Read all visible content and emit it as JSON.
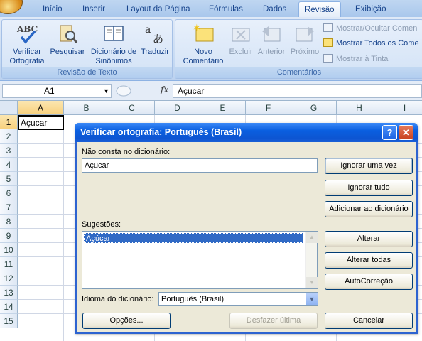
{
  "ribbon": {
    "tabs": [
      {
        "label": "Início"
      },
      {
        "label": "Inserir"
      },
      {
        "label": "Layout da Página"
      },
      {
        "label": "Fórmulas"
      },
      {
        "label": "Dados"
      },
      {
        "label": "Revisão"
      },
      {
        "label": "Exibição"
      }
    ],
    "active_tab": "Revisão",
    "groups": {
      "revisao_texto": {
        "label": "Revisão de Texto",
        "buttons": {
          "verificar": {
            "line1": "Verificar",
            "line2": "Ortografia"
          },
          "pesquisar": {
            "line1": "Pesquisar",
            "line2": ""
          },
          "dicionario": {
            "line1": "Dicionário de",
            "line2": "Sinônimos"
          },
          "traduzir": {
            "line1": "Traduzir",
            "line2": ""
          }
        }
      },
      "comentarios": {
        "label": "Comentários",
        "buttons": {
          "novo": {
            "line1": "Novo",
            "line2": "Comentário"
          },
          "excluir": {
            "line1": "Excluir"
          },
          "anterior": {
            "line1": "Anterior"
          },
          "proximo": {
            "line1": "Próximo"
          }
        },
        "small_buttons": {
          "mostrar_ocultar": "Mostrar/Ocultar Comen",
          "mostrar_todos": "Mostrar Todos os Come",
          "mostrar_tinta": "Mostrar à Tinta"
        }
      }
    }
  },
  "formula_bar": {
    "name_box": "A1",
    "fx": "fx",
    "content": "Açucar"
  },
  "grid": {
    "columns": [
      "A",
      "B",
      "C",
      "D",
      "E",
      "F",
      "G",
      "H",
      "I"
    ],
    "rows": [
      "1",
      "2",
      "3",
      "4",
      "5",
      "6",
      "7",
      "8",
      "9",
      "10",
      "11",
      "12",
      "13",
      "14",
      "15"
    ],
    "active_cell_value": "Açucar"
  },
  "dialog": {
    "title": "Verificar ortografia: Português (Brasil)",
    "help": "?",
    "close": "✕",
    "not_in_dict_label": "Não consta no dicionário:",
    "not_in_dict_value": "Açucar",
    "suggestions_label": "Sugestões:",
    "suggestions": [
      "Açúcar"
    ],
    "language_label": "Idioma do dicionário:",
    "language_value": "Português (Brasil)",
    "buttons": {
      "ignore_once": "Ignorar uma vez",
      "ignore_all": "Ignorar tudo",
      "add_to_dict": "Adicionar ao dicionário",
      "change": "Alterar",
      "change_all": "Alterar todas",
      "autocorrect": "AutoCorreção",
      "options": "Opções...",
      "undo_last": "Desfazer última",
      "cancel": "Cancelar"
    }
  },
  "colors": {
    "title_bar": "#0a5fe0",
    "dialog_bg": "#ece9d8",
    "selection": "#316ac5",
    "ribbon_bg": "#c6daf3"
  }
}
